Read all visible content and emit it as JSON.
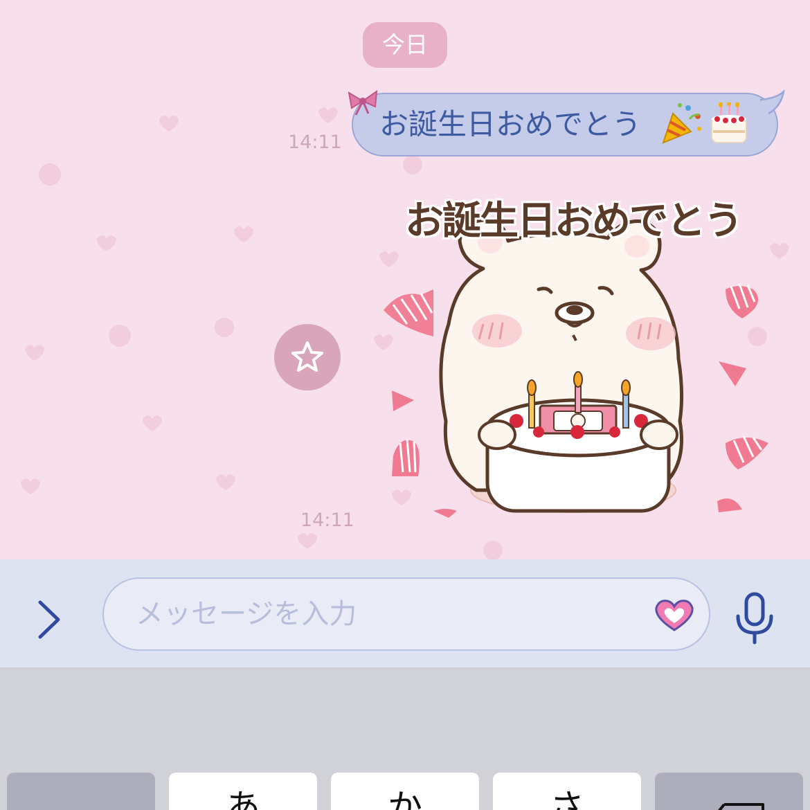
{
  "chat": {
    "date_label": "今日",
    "messages": [
      {
        "type": "text",
        "text": "お誕生日おめでとう",
        "emojis": [
          "party-popper-icon",
          "birthday-cake-icon"
        ],
        "time": "14:11"
      },
      {
        "type": "sticker",
        "caption": "お誕生日おめでとう",
        "description": "bear-with-birthday-cake",
        "time": "14:11"
      }
    ]
  },
  "input_bar": {
    "placeholder": "メッセージを入力",
    "icons": [
      "chevron-right-icon",
      "heart-emoji-icon",
      "microphone-icon"
    ]
  },
  "keyboard": {
    "keys": [
      "",
      "あ",
      "か",
      "さ",
      ""
    ]
  },
  "colors": {
    "chat_background": "#f7e0eb",
    "bubble_background": "#c4ccea",
    "bubble_text": "#3e5aa0",
    "date_pill": "#e9b1c8",
    "input_bar_background": "#dde3f1",
    "keyboard_background": "#d1d1d8",
    "accent": "#2f4a9e"
  }
}
